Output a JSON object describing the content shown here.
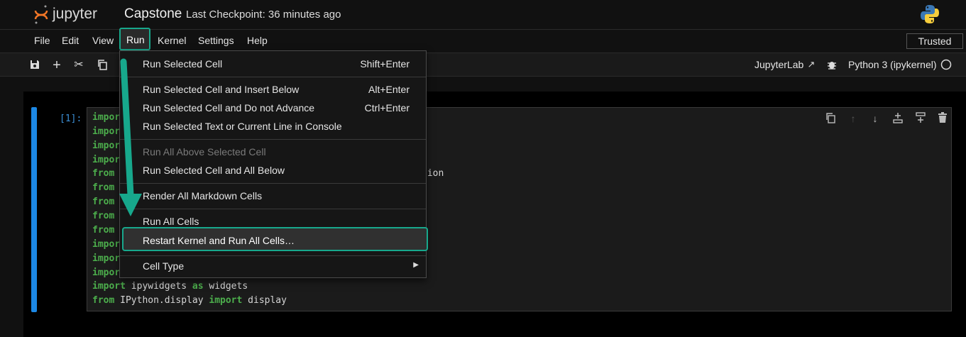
{
  "header": {
    "logo_text": "jupyter",
    "notebook_title": "Capstone",
    "checkpoint": "Last Checkpoint: 36 minutes ago"
  },
  "menubar": {
    "items": [
      "File",
      "Edit",
      "View",
      "Run",
      "Kernel",
      "Settings",
      "Help"
    ],
    "trusted": "Trusted"
  },
  "toolbar": {
    "jupyterlab_link": "JupyterLab",
    "kernel_name": "Python 3 (ipykernel)"
  },
  "run_menu": {
    "items": [
      {
        "label": "Run Selected Cell",
        "shortcut": "Shift+Enter"
      },
      {
        "label": "Run Selected Cell and Insert Below",
        "shortcut": "Alt+Enter"
      },
      {
        "label": "Run Selected Cell and Do not Advance",
        "shortcut": "Ctrl+Enter"
      },
      {
        "label": "Run Selected Text or Current Line in Console",
        "shortcut": ""
      },
      {
        "label": "Run All Above Selected Cell",
        "shortcut": "",
        "disabled": true
      },
      {
        "label": "Run Selected Cell and All Below",
        "shortcut": ""
      },
      {
        "label": "Render All Markdown Cells",
        "shortcut": ""
      },
      {
        "label": "Run All Cells",
        "shortcut": ""
      },
      {
        "label": "Restart Kernel and Run All Cells…",
        "shortcut": "",
        "highlighted": true
      },
      {
        "label": "Cell Type",
        "shortcut": "",
        "submenu": true
      }
    ]
  },
  "cell": {
    "prompt": "[1]:",
    "code_fragments": [
      {
        "kw": "impor",
        "rest": ""
      },
      {
        "kw": "impor",
        "rest": ""
      },
      {
        "kw": "impor",
        "rest": ""
      },
      {
        "kw": "impor",
        "rest": ""
      },
      {
        "kw": "from",
        "rest": ""
      },
      {
        "kw": "from",
        "rest": ""
      },
      {
        "kw": "from",
        "rest": ""
      },
      {
        "kw": "from",
        "rest": ""
      },
      {
        "kw": "from",
        "rest": ""
      },
      {
        "kw": "impor",
        "rest": ""
      },
      {
        "kw": "impor",
        "rest": ""
      },
      {
        "kw": "impor",
        "rest": ""
      }
    ],
    "visible_tail": "sion",
    "line13": {
      "kw1": "import",
      "mid": " ipywidgets ",
      "kw2": "as",
      "end": " widgets"
    },
    "line14": {
      "kw1": "from",
      "mid": " IPython.display ",
      "kw2": "import",
      "end": " display"
    }
  },
  "colors": {
    "accent_teal": "#17a88c",
    "cell_bar_blue": "#1c88e5",
    "keyword_green": "#4cae4c"
  }
}
